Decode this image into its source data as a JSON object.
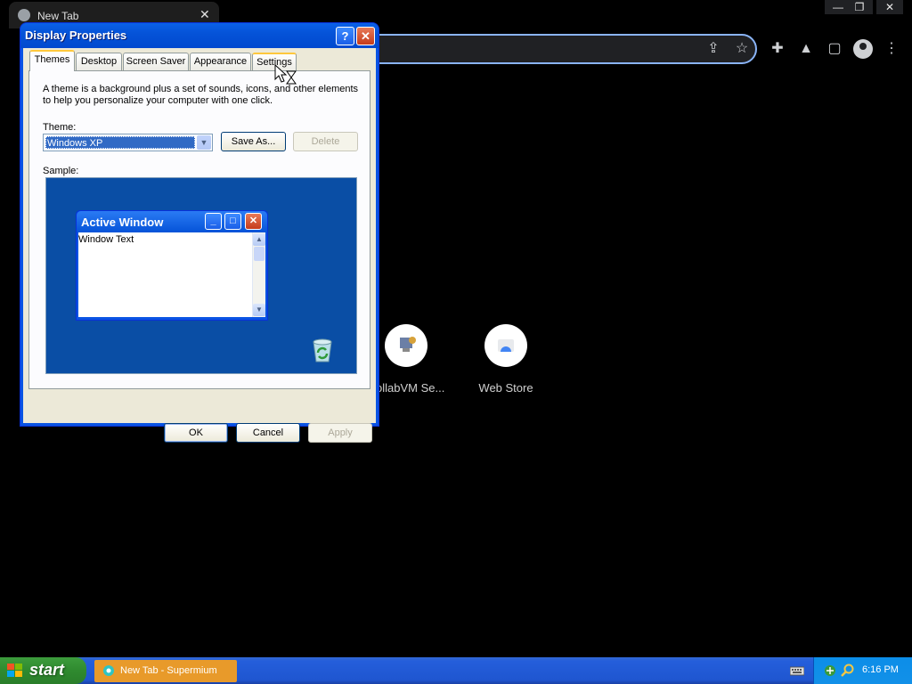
{
  "browser": {
    "tab_title": "New Tab",
    "tab_close": "✕",
    "window_controls": [
      "—",
      "❐",
      "✕"
    ],
    "toolbar_icons": [
      "share-icon",
      "star-icon",
      "extensions-icon",
      "labs-icon",
      "sidebar-icon",
      "profile-icon",
      "menu-icon"
    ],
    "shortcuts": [
      {
        "label": "CollabVM Se..."
      },
      {
        "label": "Web Store"
      }
    ]
  },
  "dialog": {
    "title": "Display Properties",
    "help": "?",
    "close": "✕",
    "tabs": [
      "Themes",
      "Desktop",
      "Screen Saver",
      "Appearance",
      "Settings"
    ],
    "active_tab": "Themes",
    "description": "A theme is a background plus a set of sounds, icons, and other elements to help you personalize your computer with one click.",
    "theme_label": "Theme:",
    "theme_value": "Windows XP",
    "save_as": "Save As...",
    "delete": "Delete",
    "sample_label": "Sample:",
    "sample_window_title": "Active Window",
    "sample_window_text": "Window Text",
    "ok": "OK",
    "cancel": "Cancel",
    "apply": "Apply"
  },
  "taskbar": {
    "start": "start",
    "task_item": "New Tab - Supermium",
    "clock": "6:16 PM"
  }
}
